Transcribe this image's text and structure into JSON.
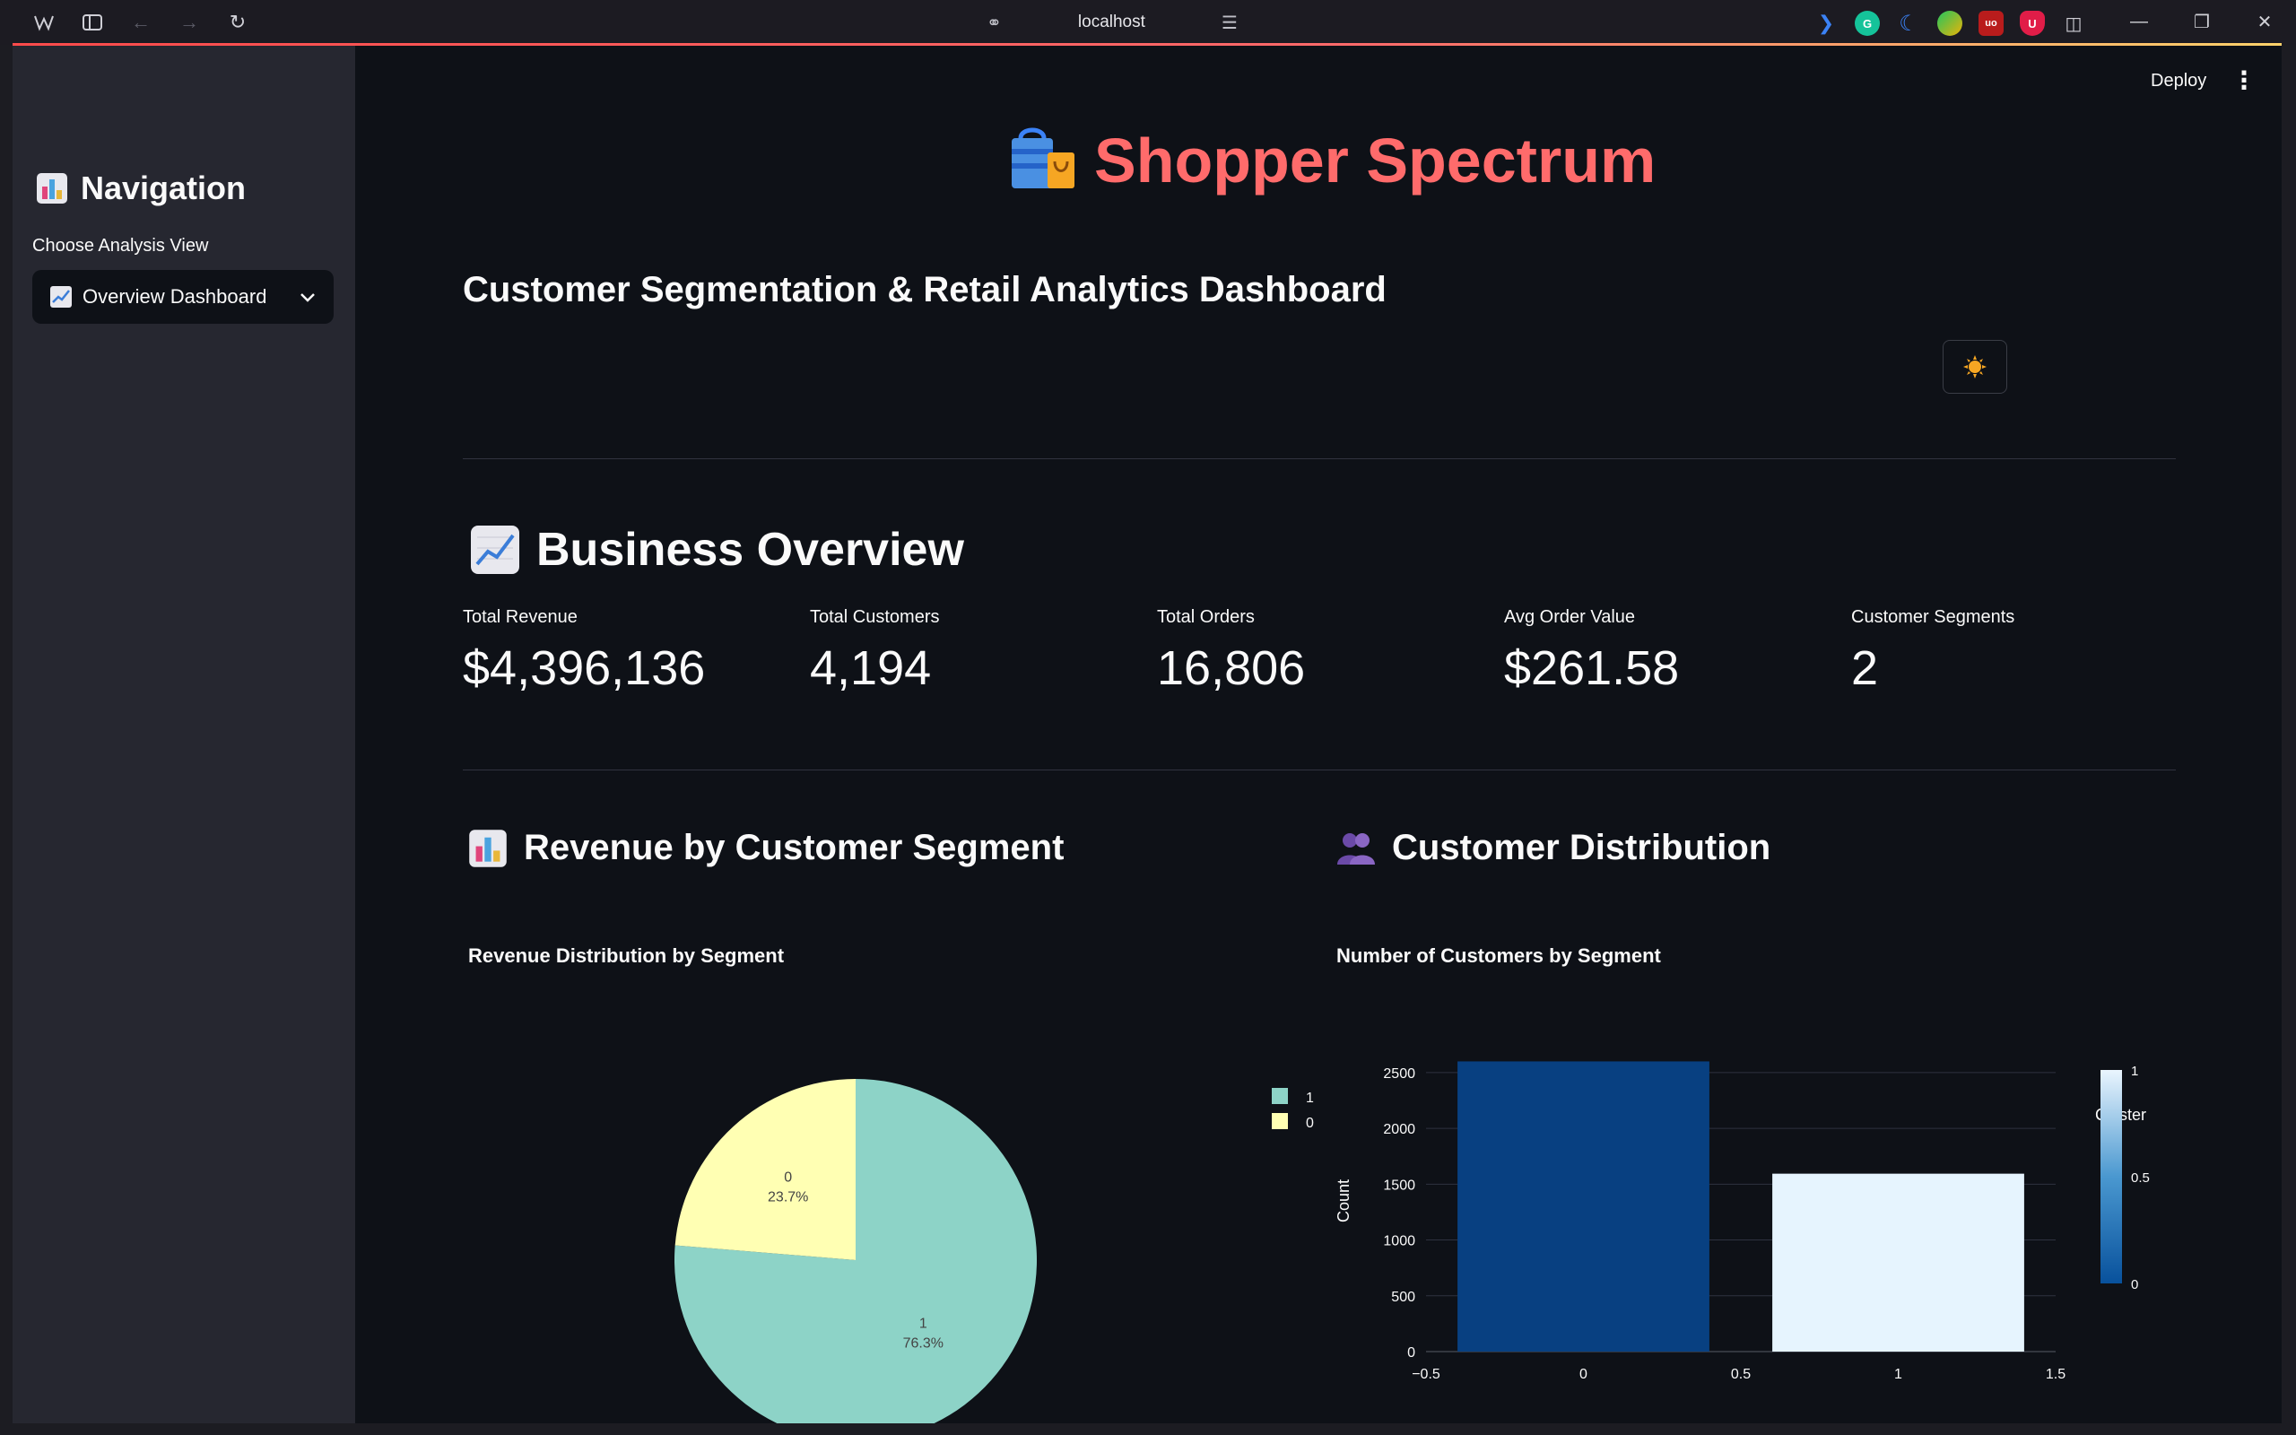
{
  "browser": {
    "url": "localhost"
  },
  "topbar": {
    "deploy_label": "Deploy",
    "menu_icon": "⋮"
  },
  "sidebar": {
    "title": "Navigation",
    "choose_label": "Choose Analysis View",
    "select_value": "Overview Dashboard"
  },
  "header": {
    "title": "Shopper Spectrum",
    "subtitle": "Customer Segmentation & Retail Analytics Dashboard",
    "theme_icon": "sun-icon"
  },
  "overview": {
    "heading": "Business Overview",
    "metrics": [
      {
        "label": "Total Revenue",
        "value": "$4,396,136"
      },
      {
        "label": "Total Customers",
        "value": "4,194"
      },
      {
        "label": "Total Orders",
        "value": "16,806"
      },
      {
        "label": "Avg Order Value",
        "value": "$261.58"
      },
      {
        "label": "Customer Segments",
        "value": "2"
      }
    ]
  },
  "revenue_section": {
    "heading": "Revenue by Customer Segment"
  },
  "distribution_section": {
    "heading": "Customer Distribution"
  },
  "colors": {
    "accent": "#ff6b6b",
    "background": "#0e1117",
    "sidebar": "#262730",
    "pie_segment_1": "#8dd3c7",
    "pie_segment_0": "#ffffb3",
    "bar_cluster_0": "#084081",
    "bar_cluster_1": "#e6f4fe"
  },
  "chart_data": [
    {
      "type": "pie",
      "title": "Revenue Distribution by Segment",
      "labels": [
        "1",
        "0"
      ],
      "values": [
        76.3,
        23.7
      ],
      "slice_labels": [
        {
          "name": "1",
          "pct": "76.3%"
        },
        {
          "name": "0",
          "pct": "23.7%"
        }
      ],
      "legend": [
        "1",
        "0"
      ],
      "legend_position": "top-right"
    },
    {
      "type": "bar",
      "title": "Number of Customers by Segment",
      "x": [
        0,
        1
      ],
      "values": [
        2600,
        1594
      ],
      "ylabel": "Count",
      "xlim": [
        -0.5,
        1.5
      ],
      "ylim": [
        0,
        2700
      ],
      "xticks": [
        "−0.5",
        "0",
        "0.5",
        "1",
        "1.5"
      ],
      "yticks": [
        "0",
        "500",
        "1000",
        "1500",
        "2000",
        "2500"
      ],
      "grid": true,
      "colorbar": {
        "title": "Cluster",
        "ticks": [
          "1",
          "0.5",
          "0"
        ]
      }
    }
  ]
}
